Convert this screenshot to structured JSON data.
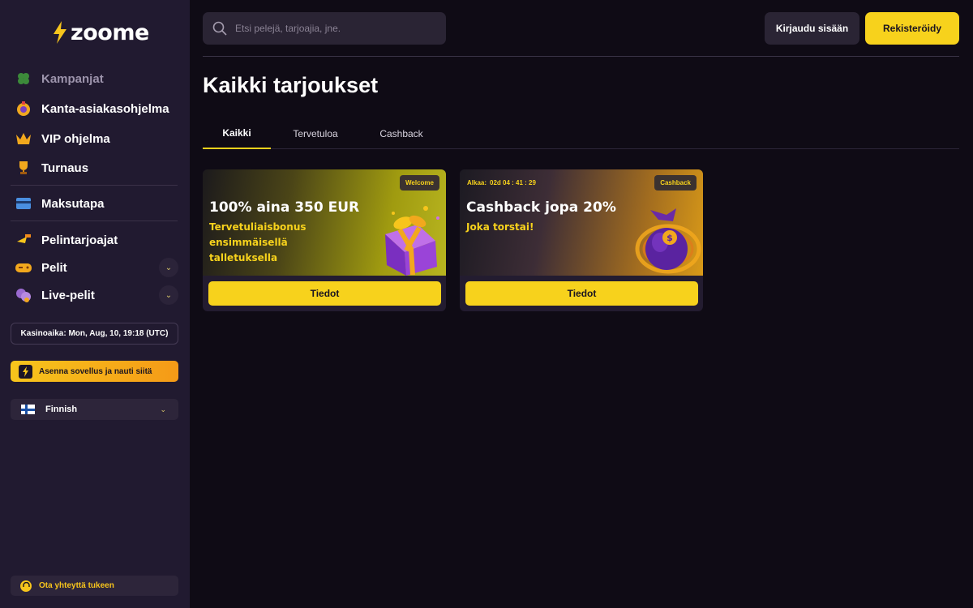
{
  "brand": {
    "name": "zoome"
  },
  "sidebar": {
    "items": [
      {
        "label": "Kampanjat",
        "icon": "clover-icon"
      },
      {
        "label": "Kanta-asiakasohjelma",
        "icon": "loyalty-icon"
      },
      {
        "label": "VIP ohjelma",
        "icon": "crown-icon"
      },
      {
        "label": "Turnaus",
        "icon": "trophy-icon"
      },
      {
        "label": "Maksutapa",
        "icon": "card-icon"
      },
      {
        "label": "Pelintarjoajat",
        "icon": "providers-icon"
      },
      {
        "label": "Pelit",
        "icon": "gamepad-icon"
      },
      {
        "label": "Live-pelit",
        "icon": "live-icon"
      }
    ],
    "casino_time": "Kasinoaika: Mon, Aug, 10, 19:18 (UTC)",
    "install_label": "Asenna sovellus ja nauti siitä",
    "language": "Finnish",
    "support_label": "Ota yhteyttä tukeen"
  },
  "header": {
    "search_placeholder": "Etsi pelejä, tarjoajia, jne.",
    "login_label": "Kirjaudu sisään",
    "register_label": "Rekisteröidy"
  },
  "main": {
    "title": "Kaikki tarjoukset",
    "tabs": [
      {
        "label": "Kaikki",
        "active": true
      },
      {
        "label": "Tervetuloa",
        "active": false
      },
      {
        "label": "Cashback",
        "active": false
      }
    ],
    "offers": [
      {
        "badge": "Welcome",
        "title": "100% aina 350 EUR",
        "subtitle": "Tervetuliaisbonus ensimmäisellä talletuksella",
        "button": "Tiedot"
      },
      {
        "badge": "Cashback",
        "timer_label": "Alkaa:",
        "timer_value": "02d 04 : 41 : 29",
        "title": "Cashback jopa 20%",
        "subtitle": "Joka torstai!",
        "button": "Tiedot"
      }
    ]
  },
  "colors": {
    "accent": "#f7d21c",
    "sidebar": "#211a30",
    "background": "#0f0b15"
  }
}
